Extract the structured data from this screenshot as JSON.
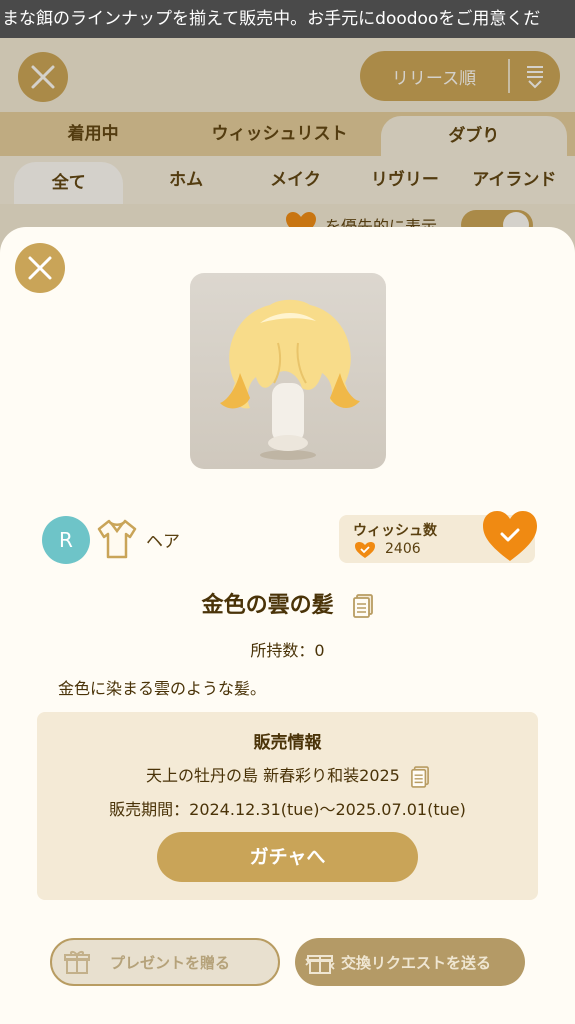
{
  "marquee": {
    "text": "まな餌のラインナップを揃えて販売中。お手元にdoodooをご用意くだ"
  },
  "header": {
    "close_icon": "close-icon",
    "sort_label": "リリース順",
    "sort_icon": "sort-icon"
  },
  "tabs_primary": [
    {
      "label": "着用中"
    },
    {
      "label": "ウィッシュリスト"
    },
    {
      "label": "ダブり",
      "active": true
    }
  ],
  "tabs_secondary": [
    {
      "label": "全て",
      "active": true
    },
    {
      "label": "ホム"
    },
    {
      "label": "メイク"
    },
    {
      "label": "リヴリー"
    },
    {
      "label": "アイランド"
    }
  ],
  "preference": {
    "text": "を優先的に表示",
    "toggle_on": true
  },
  "item": {
    "rarity": "R",
    "category": "ヘア",
    "wish_label": "ウィッシュ数",
    "wish_count": "2406",
    "name": "金色の雲の髪",
    "owned": "所持数：0",
    "description": "金色に染まる雲のような髪。"
  },
  "sale": {
    "title": "販売情報",
    "event": "天上の牡丹の島 新春彩り和装2025",
    "period": "販売期間：2024.12.31(tue)〜2025.07.01(tue)",
    "gacha_button": "ガチャへ"
  },
  "actions": {
    "present_label": "プレゼントを贈る",
    "exchange_label": "交換リクエストを送る"
  },
  "colors": {
    "accent": "#c9a458",
    "rarity_r": "#6ec4c8",
    "wish_heart": "#f08a12"
  }
}
